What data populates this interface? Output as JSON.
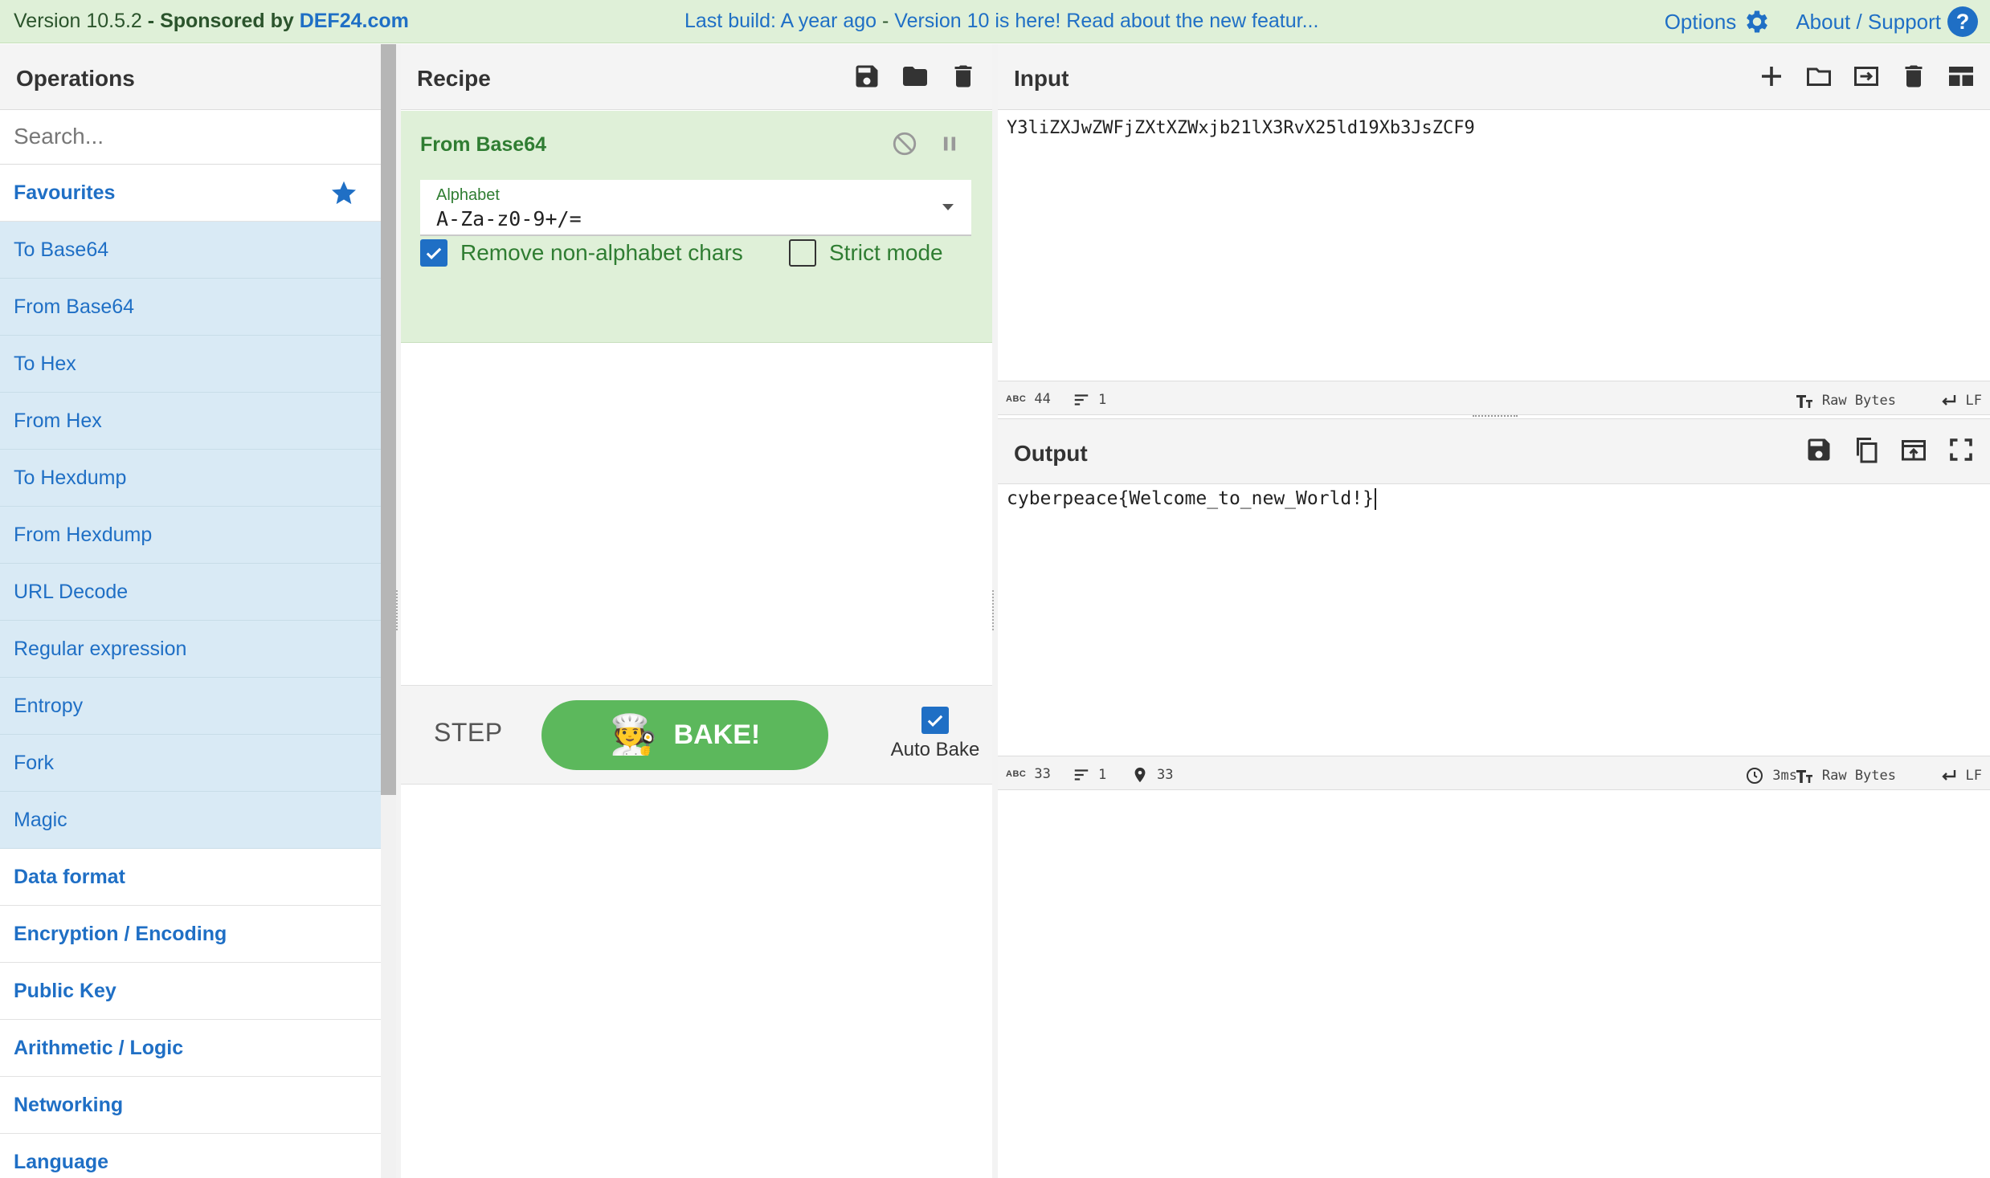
{
  "banner": {
    "version": "Version 10.5.2",
    "dash": " - ",
    "sponsored": "Sponsored by",
    "sponsor": "DEF24.com",
    "last_build": "Last build: A year ago",
    "separator": " - ",
    "news": "Version 10 is here! Read about the new featur...",
    "options": "Options",
    "about": "About / Support",
    "about_icon": "?"
  },
  "operations": {
    "title": "Operations",
    "search_placeholder": "Search...",
    "favourites_label": "Favourites",
    "favourites": [
      "To Base64",
      "From Base64",
      "To Hex",
      "From Hex",
      "To Hexdump",
      "From Hexdump",
      "URL Decode",
      "Regular expression",
      "Entropy",
      "Fork",
      "Magic"
    ],
    "categories": [
      "Data format",
      "Encryption / Encoding",
      "Public Key",
      "Arithmetic / Logic",
      "Networking",
      "Language"
    ]
  },
  "recipe": {
    "title": "Recipe",
    "operation": {
      "name": "From Base64",
      "alphabet_label": "Alphabet",
      "alphabet_value": "A-Za-z0-9+/=",
      "remove_nonalpha_label": "Remove non-alphabet chars",
      "remove_nonalpha_checked": true,
      "strict_mode_label": "Strict mode",
      "strict_mode_checked": false
    },
    "step_label": "STEP",
    "bake_label": "BAKE!",
    "chef_glyph": "🧑‍🍳",
    "auto_bake_label": "Auto Bake",
    "auto_bake_checked": true
  },
  "input": {
    "title": "Input",
    "text": "Y3liZXJwZWFjZXtXZWxjb21lX3RvX25ld19Xb3JsZCF9",
    "length": "44",
    "lines": "1",
    "encoding": "Raw Bytes",
    "eol": "LF"
  },
  "output": {
    "title": "Output",
    "text": "cyberpeace{Welcome_to_new_World!}",
    "length": "33",
    "lines": "1",
    "position": "33",
    "time": "3ms",
    "encoding": "Raw Bytes",
    "eol": "LF"
  },
  "colors": {
    "accent": "#1f6fc5",
    "banner_bg": "#dff0d8",
    "op_card_bg": "#dff0d8",
    "favourite_bg": "#d9eaf5",
    "bake_green": "#5cb85c"
  },
  "icons": {
    "options": "gear-icon",
    "about": "help-icon",
    "favourites": "star-icon",
    "recipe_save": "save-icon",
    "recipe_load": "folder-icon",
    "recipe_clear": "trash-icon",
    "op_disable": "disable-icon",
    "op_breakpoint": "pause-icon",
    "input_add": "plus-icon",
    "input_open": "folder-icon",
    "input_load": "import-icon",
    "input_clear": "trash-icon",
    "input_layout": "layout-icon",
    "output_save": "save-icon",
    "output_copy": "copy-icon",
    "output_replace": "export-icon",
    "output_maximise": "fullscreen-icon"
  }
}
